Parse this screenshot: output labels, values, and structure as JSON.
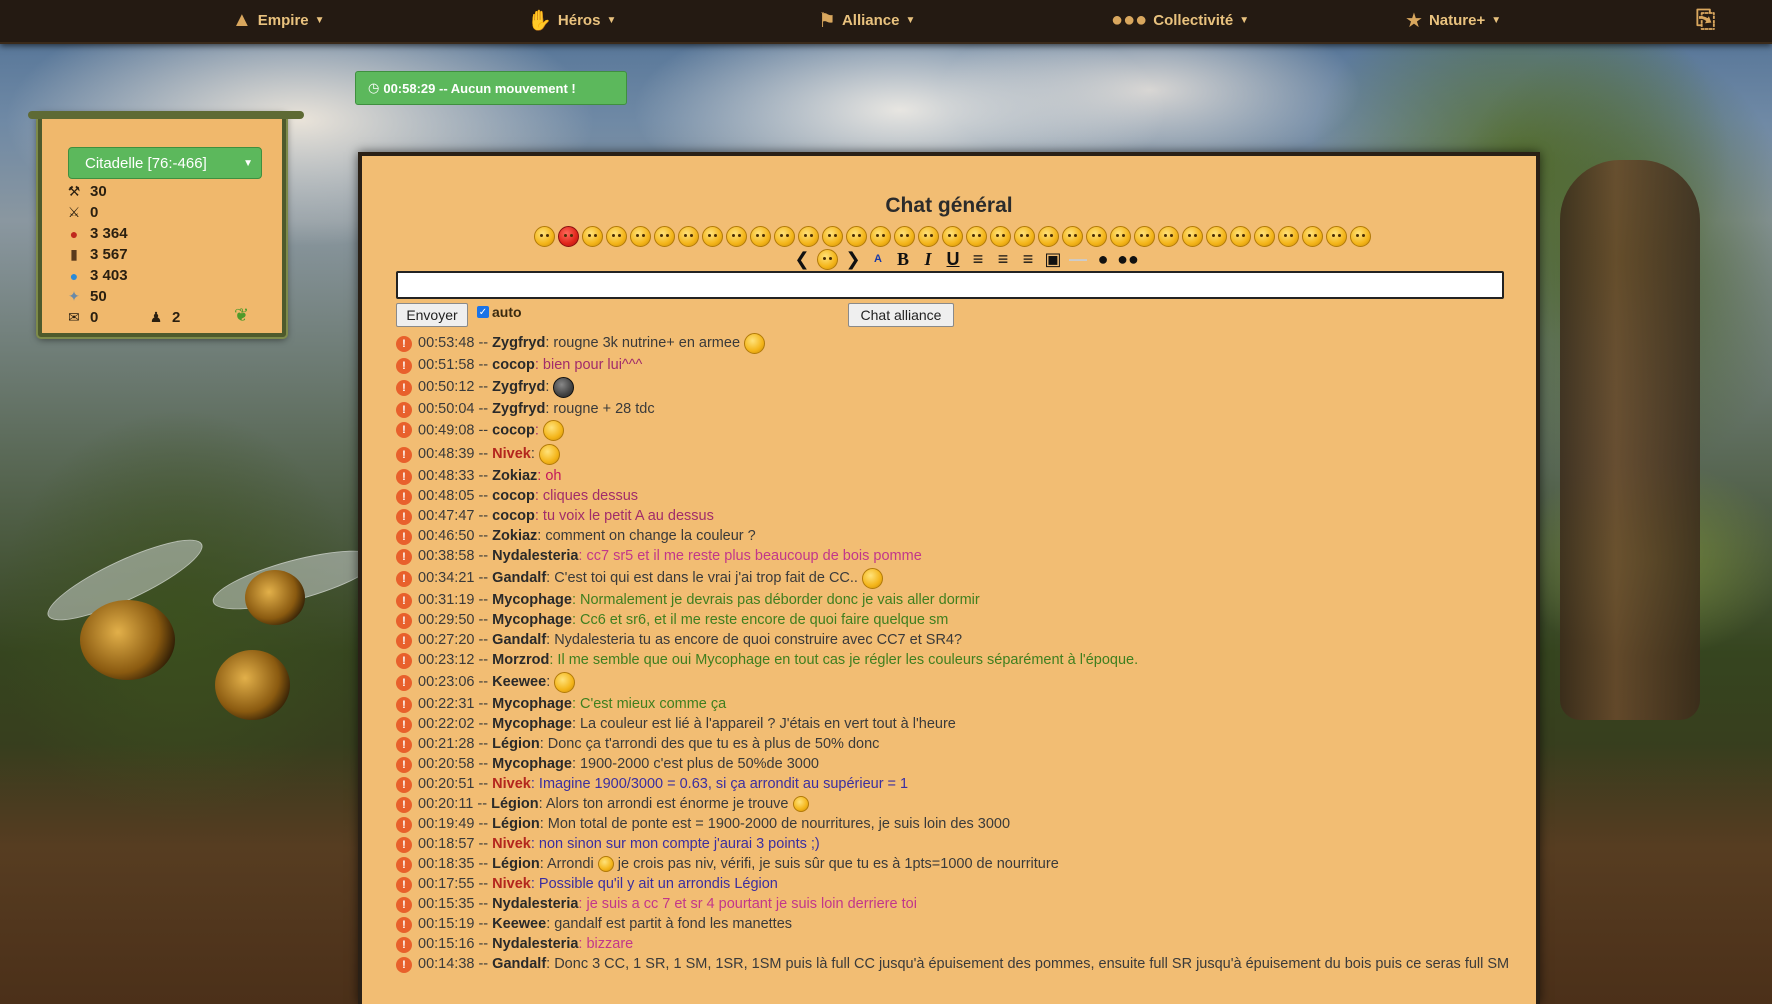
{
  "navbar": {
    "items": [
      {
        "label": "Empire",
        "icon": "pyramid-icon"
      },
      {
        "label": "Héros",
        "icon": "hand-icon"
      },
      {
        "label": "Alliance",
        "icon": "flag-icon"
      },
      {
        "label": "Collectivité",
        "icon": "group-icon"
      },
      {
        "label": "Nature+",
        "icon": "star-icon"
      }
    ],
    "logout_icon": "exit-icon"
  },
  "timer": {
    "text": "00:58:29 -- Aucun mouvement !",
    "icon": "clock-icon"
  },
  "city": {
    "selected": "Citadelle [76:-466]"
  },
  "resources": {
    "hammer": "30",
    "sword": "0",
    "apple": "3 364",
    "wood": "3 567",
    "water": "3 403",
    "gem": "50",
    "mail": "0",
    "members": "2"
  },
  "chat": {
    "title": "Chat général",
    "input_value": "",
    "send_label": "Envoyer",
    "auto_label": "auto",
    "alliance_label": "Chat alliance",
    "messages": [
      {
        "time": "00:53:48 --",
        "author": "Zygfryd",
        "text": ": rougne 3k nutrine+ en armee",
        "color": "#3a3a3a",
        "emoji": true,
        "tall": true
      },
      {
        "time": "00:51:58 --",
        "author": "cocop",
        "text": ": bien pour lui^^^",
        "color": "#a12c6a"
      },
      {
        "time": "00:50:12 --",
        "author": "Zygfryd",
        "text": ":",
        "color": "#3a3a3a",
        "emoji": true,
        "emojiDark": true,
        "tall": true
      },
      {
        "time": "00:50:04 --",
        "author": "Zygfryd",
        "text": ": rougne + 28 tdc",
        "color": "#3a3a3a"
      },
      {
        "time": "00:49:08 --",
        "author": "cocop",
        "text": ":",
        "color": "#a12c6a",
        "emoji": true
      },
      {
        "time": "00:48:39 --",
        "author": "Nivek",
        "text": ":",
        "color": "#3a3a3a",
        "emoji": true,
        "authorRed": true,
        "tall": true
      },
      {
        "time": "00:48:33 --",
        "author": "Zokiaz",
        "text": ": oh",
        "color": "#c2185b"
      },
      {
        "time": "00:48:05 --",
        "author": "cocop",
        "text": ": cliques dessus",
        "color": "#a12c6a"
      },
      {
        "time": "00:47:47 --",
        "author": "cocop",
        "text": ": tu voix le petit A au dessus",
        "color": "#a12c6a"
      },
      {
        "time": "00:46:50 --",
        "author": "Zokiaz",
        "text": ": comment on change la couleur ?",
        "color": "#3a3a3a"
      },
      {
        "time": "00:38:58 --",
        "author": "Nydalesteria",
        "text": ": cc7 sr5 et il me reste plus beaucoup de bois pomme",
        "color": "#c2378a"
      },
      {
        "time": "00:34:21 --",
        "author": "Gandalf",
        "text": ": C'est toi qui est dans le vrai j'ai trop fait de CC..",
        "color": "#3a3a3a",
        "emoji": true,
        "tall": true
      },
      {
        "time": "00:31:19 --",
        "author": "Mycophage",
        "text": ": Normalement je devrais pas déborder donc je vais aller dormir",
        "color": "#3f7f1f"
      },
      {
        "time": "00:29:50 --",
        "author": "Mycophage",
        "text": ": Cc6 et sr6, et il me reste encore de quoi faire quelque sm",
        "color": "#3f7f1f"
      },
      {
        "time": "00:27:20 --",
        "author": "Gandalf",
        "text": ": Nydalesteria tu as encore de quoi construire avec CC7 et SR4?",
        "color": "#3a3a3a"
      },
      {
        "time": "00:23:12 --",
        "author": "Morzrod",
        "text": ": Il me semble que oui Mycophage en tout cas je régler les couleurs séparément à l'époque.",
        "color": "#3f7f1f"
      },
      {
        "time": "00:23:06 --",
        "author": "Keewee",
        "text": ":",
        "color": "#3a3a3a",
        "emoji": true,
        "tall": true
      },
      {
        "time": "00:22:31 --",
        "author": "Mycophage",
        "text": ": C'est mieux comme ça",
        "color": "#3f7f1f"
      },
      {
        "time": "00:22:02 --",
        "author": "Mycophage",
        "text": ": La couleur est lié à l'appareil ? J'étais en vert tout à l'heure",
        "color": "#3a3a3a"
      },
      {
        "time": "00:21:28 --",
        "author": "Légion",
        "text": ": Donc ça t'arrondi des que tu es à plus de 50% donc",
        "color": "#3a3a3a"
      },
      {
        "time": "00:20:58 --",
        "author": "Mycophage",
        "text": ": 1900-2000 c'est plus de 50%de 3000",
        "color": "#3a3a3a"
      },
      {
        "time": "00:20:51 --",
        "author": "Nivek",
        "text": ": Imagine 1900/3000 = 0.63, si ça arrondit au supérieur = 1",
        "color": "#3b2ea0",
        "authorRed": true
      },
      {
        "time": "00:20:11 --",
        "author": "Légion",
        "text": ": Alors ton arrondi est énorme je trouve",
        "color": "#3a3a3a",
        "emoji": true,
        "emojiSmall": true
      },
      {
        "time": "00:19:49 --",
        "author": "Légion",
        "text": ": Mon total de ponte est = 1900-2000 de nourritures, je suis loin des 3000",
        "color": "#3a3a3a"
      },
      {
        "time": "00:18:57 --",
        "author": "Nivek",
        "text": ": non sinon sur mon compte j'aurai 3 points ;)",
        "color": "#3b2ea0",
        "authorRed": true
      },
      {
        "time": "00:18:35 --",
        "author": "Légion",
        "text": ": Arrondi",
        "text2": " je crois pas niv, vérifi, je suis sûr que tu es à 1pts=1000 de nourriture",
        "color": "#3a3a3a",
        "emoji": true,
        "emojiSmall": true
      },
      {
        "time": "00:17:55 --",
        "author": "Nivek",
        "text": ": Possible qu'il y ait un arrondis Légion",
        "color": "#3b2ea0",
        "authorRed": true
      },
      {
        "time": "00:15:35 --",
        "author": "Nydalesteria",
        "text": ": je suis a cc 7 et sr 4 pourtant je suis loin derriere toi",
        "color": "#c2378a"
      },
      {
        "time": "00:15:19 --",
        "author": "Keewee",
        "text": ": gandalf est partit à fond les manettes",
        "color": "#3a3a3a"
      },
      {
        "time": "00:15:16 --",
        "author": "Nydalesteria",
        "text": ": bizzare",
        "color": "#c2378a"
      },
      {
        "time": "00:14:38 --",
        "author": "Gandalf",
        "text": ": Donc 3 CC, 1 SR, 1 SM, 1SR, 1SM puis là full CC jusqu'à épuisement des pommes, ensuite full SR jusqu'à épuisement du bois puis ce seras full SM",
        "color": "#3a3a3a",
        "wrap": true
      }
    ]
  }
}
